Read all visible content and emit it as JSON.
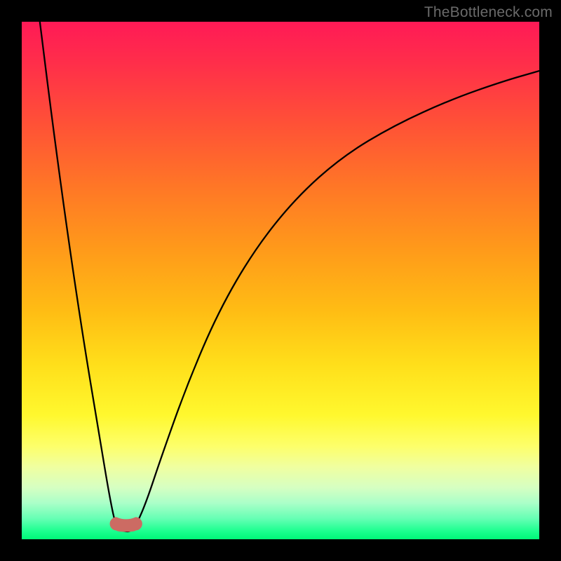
{
  "watermark": "TheBottleneck.com",
  "colors": {
    "frame": "#000000",
    "curve_stroke": "#000000",
    "trough_fill": "#cc6b63",
    "gradient_top": "#ff1a56",
    "gradient_bottom": "#00f878"
  },
  "chart_data": {
    "type": "line",
    "title": "",
    "xlabel": "",
    "ylabel": "",
    "xlim": [
      0,
      100
    ],
    "ylim": [
      0,
      100
    ],
    "series": [
      {
        "name": "bottleneck-curve",
        "x": [
          3.5,
          6,
          9,
          12,
          15,
          17,
          18.3,
          20,
          21,
          22,
          24,
          27,
          32,
          38,
          45,
          53,
          62,
          72,
          83,
          93,
          100
        ],
        "values": [
          100,
          80,
          58,
          38,
          20,
          8,
          2,
          1.5,
          1.5,
          2.5,
          7,
          16,
          30,
          44,
          56,
          66,
          74,
          80,
          85,
          88.5,
          90.5
        ]
      }
    ],
    "annotations": [
      {
        "name": "trough-marker",
        "x_range": [
          18.3,
          22
        ],
        "y": 1.5,
        "note": "rounded marker at curve minimum"
      }
    ]
  }
}
